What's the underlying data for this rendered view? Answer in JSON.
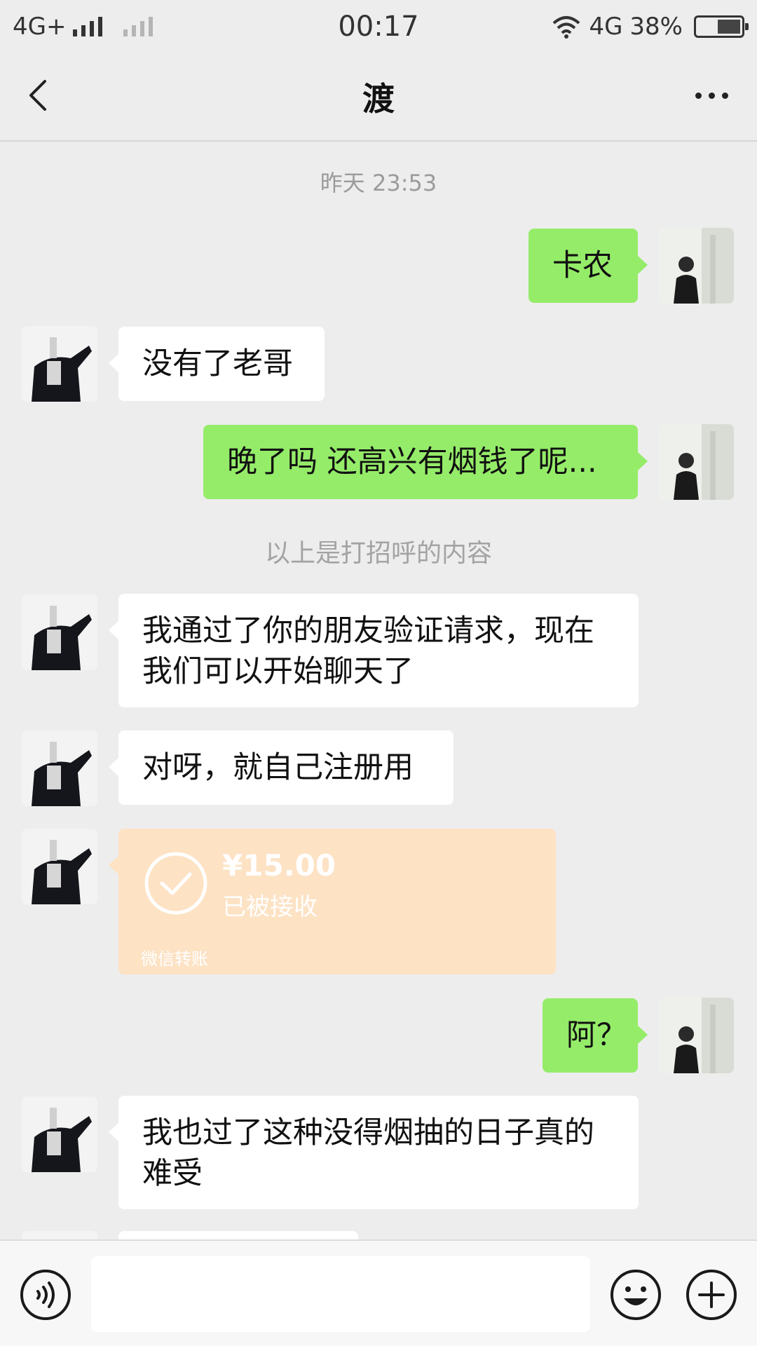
{
  "status_bar": {
    "network_left": "4G+",
    "time": "00:17",
    "network_right": "4G",
    "battery": "38%"
  },
  "header": {
    "title": "渡"
  },
  "messages": {
    "timestamp": "昨天 23:53",
    "m1": "卡农",
    "m2": "没有了老哥",
    "m3": "晚了吗 还高兴有烟钱了呢...",
    "system_note": "以上是打招呼的内容",
    "m4_line1": "我通过了你的朋友验证请求，现在",
    "m4_line2": "我们可以开始聊天了",
    "m5": "对呀，就自己注册用",
    "transfer": {
      "amount": "¥15.00",
      "status": "已被接收",
      "label": "微信转账"
    },
    "m6": "阿？",
    "m7_line1": "我也过了这种没得烟抽的日子真的",
    "m7_line2": "难受"
  },
  "input": {
    "value": "",
    "placeholder": ""
  },
  "colors": {
    "background": "#ededed",
    "my_bubble": "#95ec69",
    "friend_bubble": "#ffffff",
    "transfer_card": "#fde2c4"
  }
}
